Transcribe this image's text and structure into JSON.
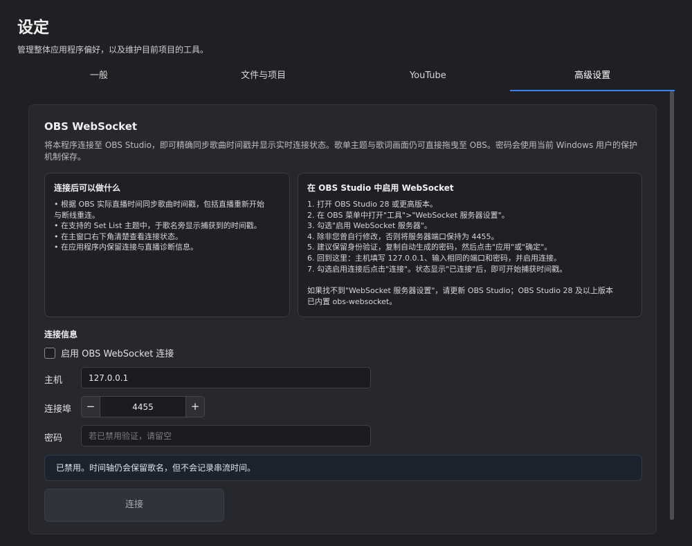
{
  "header": {
    "title": "设定",
    "subtitle": "管理整体应用程序偏好，以及维护目前项目的工具。"
  },
  "tabs": [
    {
      "label": "一般"
    },
    {
      "label": "文件与项目"
    },
    {
      "label": "YouTube"
    },
    {
      "label": "高级设置",
      "active": true
    }
  ],
  "obs": {
    "title": "OBS WebSocket",
    "description": "将本程序连接至 OBS Studio，即可精确同步歌曲时间戳并显示实时连接状态。歌单主题与歌词画面仍可直接拖曳至 OBS。密码会使用当前 Windows 用户的保护机制保存。",
    "features_card": {
      "title": "连接后可以做什么",
      "lines": [
        "• 根据 OBS 实际直播时间同步歌曲时间戳，包括直播重新开始",
        "与断线重连。",
        "• 在支持的 Set List 主题中，于歌名旁显示捕获到的时间戳。",
        "• 在主窗口右下角清楚查看连接状态。",
        "• 在应用程序内保留连接与直播诊断信息。"
      ]
    },
    "setup_card": {
      "title": "在 OBS Studio 中启用 WebSocket",
      "lines": [
        "1. 打开 OBS Studio 28 或更高版本。",
        "2. 在 OBS 菜单中打开\"工具\">\"WebSocket 服务器设置\"。",
        "3. 勾选\"启用 WebSocket 服务器\"。",
        "4. 除非您曾自行修改，否则将服务器端口保持为 4455。",
        "5. 建议保留身份验证，复制自动生成的密码，然后点击\"应用\"或\"确定\"。",
        "6. 回到这里：主机填写 127.0.0.1、输入相同的端口和密码，并启用连接。",
        "7. 勾选启用连接后点击\"连接\"。状态显示\"已连接\"后，即可开始捕获时间戳。"
      ],
      "note_lines": [
        "如果找不到\"WebSocket 服务器设置\"，请更新 OBS Studio；OBS Studio 28 及以上版本",
        "已内置 obs-websocket。"
      ]
    }
  },
  "connection": {
    "title": "连接信息",
    "enable_label": "启用 OBS WebSocket 连接",
    "enabled": false,
    "host_label": "主机",
    "host_value": "127.0.0.1",
    "port_label": "连接埠",
    "port_value": "4455",
    "minus": "−",
    "plus": "+",
    "password_label": "密码",
    "password_placeholder": "若已禁用验证，请留空",
    "status_message": "已禁用。时间轴仍会保留歌名，但不会记录串流时间。",
    "connect_label": "连接"
  },
  "colors": {
    "background": "#1f2023",
    "panel": "#26282d",
    "accent": "#3b82f6",
    "banner": "#1c232f"
  }
}
